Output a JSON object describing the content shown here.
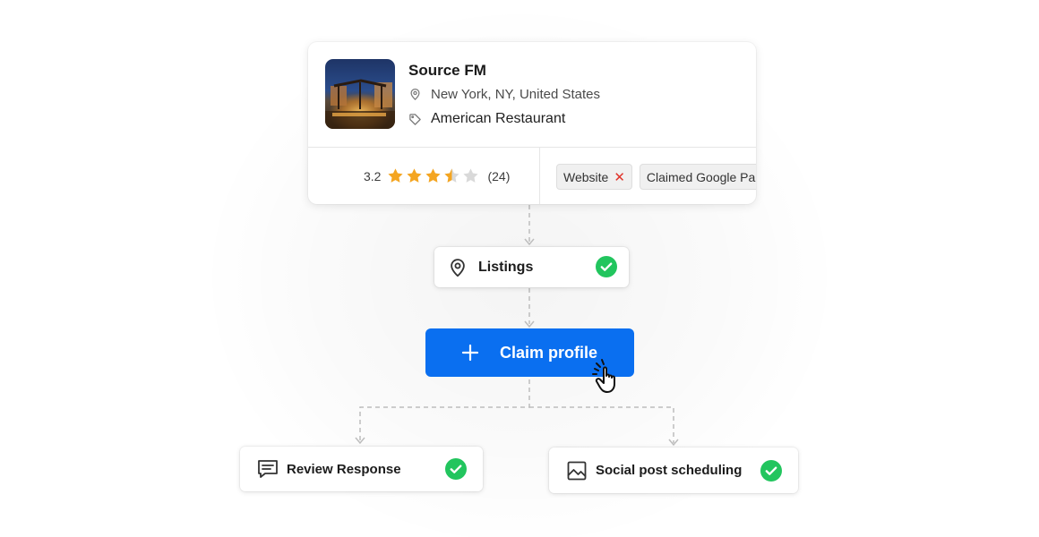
{
  "business": {
    "name": "Source FM",
    "location": "New York, NY, United States",
    "category": "American Restaurant",
    "rating": 3.2,
    "rating_label": "3.2",
    "review_count": "(24)",
    "stars_filled": 3,
    "stars_half": 1,
    "stars_total": 5
  },
  "tags": [
    {
      "label": "Website",
      "status": "missing"
    },
    {
      "label": "Claimed Google Pa",
      "status": "truncated"
    }
  ],
  "flow": {
    "listings": {
      "label": "Listings",
      "done": true
    },
    "claim_button": {
      "label": "Claim profile"
    },
    "review_response": {
      "label": "Review Response",
      "done": true
    },
    "social_scheduling": {
      "label": "Social post scheduling",
      "done": true
    }
  },
  "icons": {
    "location": "location-pin-icon",
    "category": "tag-icon",
    "listings": "location-pin-icon",
    "claim": "plus-icon",
    "cursor": "hand-pointer-icon",
    "review": "chat-message-icon",
    "social": "image-icon",
    "done": "check-circle-icon",
    "remove": "x-icon"
  },
  "colors": {
    "accent": "#0a6ff0",
    "success": "#22c55e",
    "star": "#f4a521",
    "star_empty": "#d9d9d9",
    "error": "#e0332a"
  }
}
